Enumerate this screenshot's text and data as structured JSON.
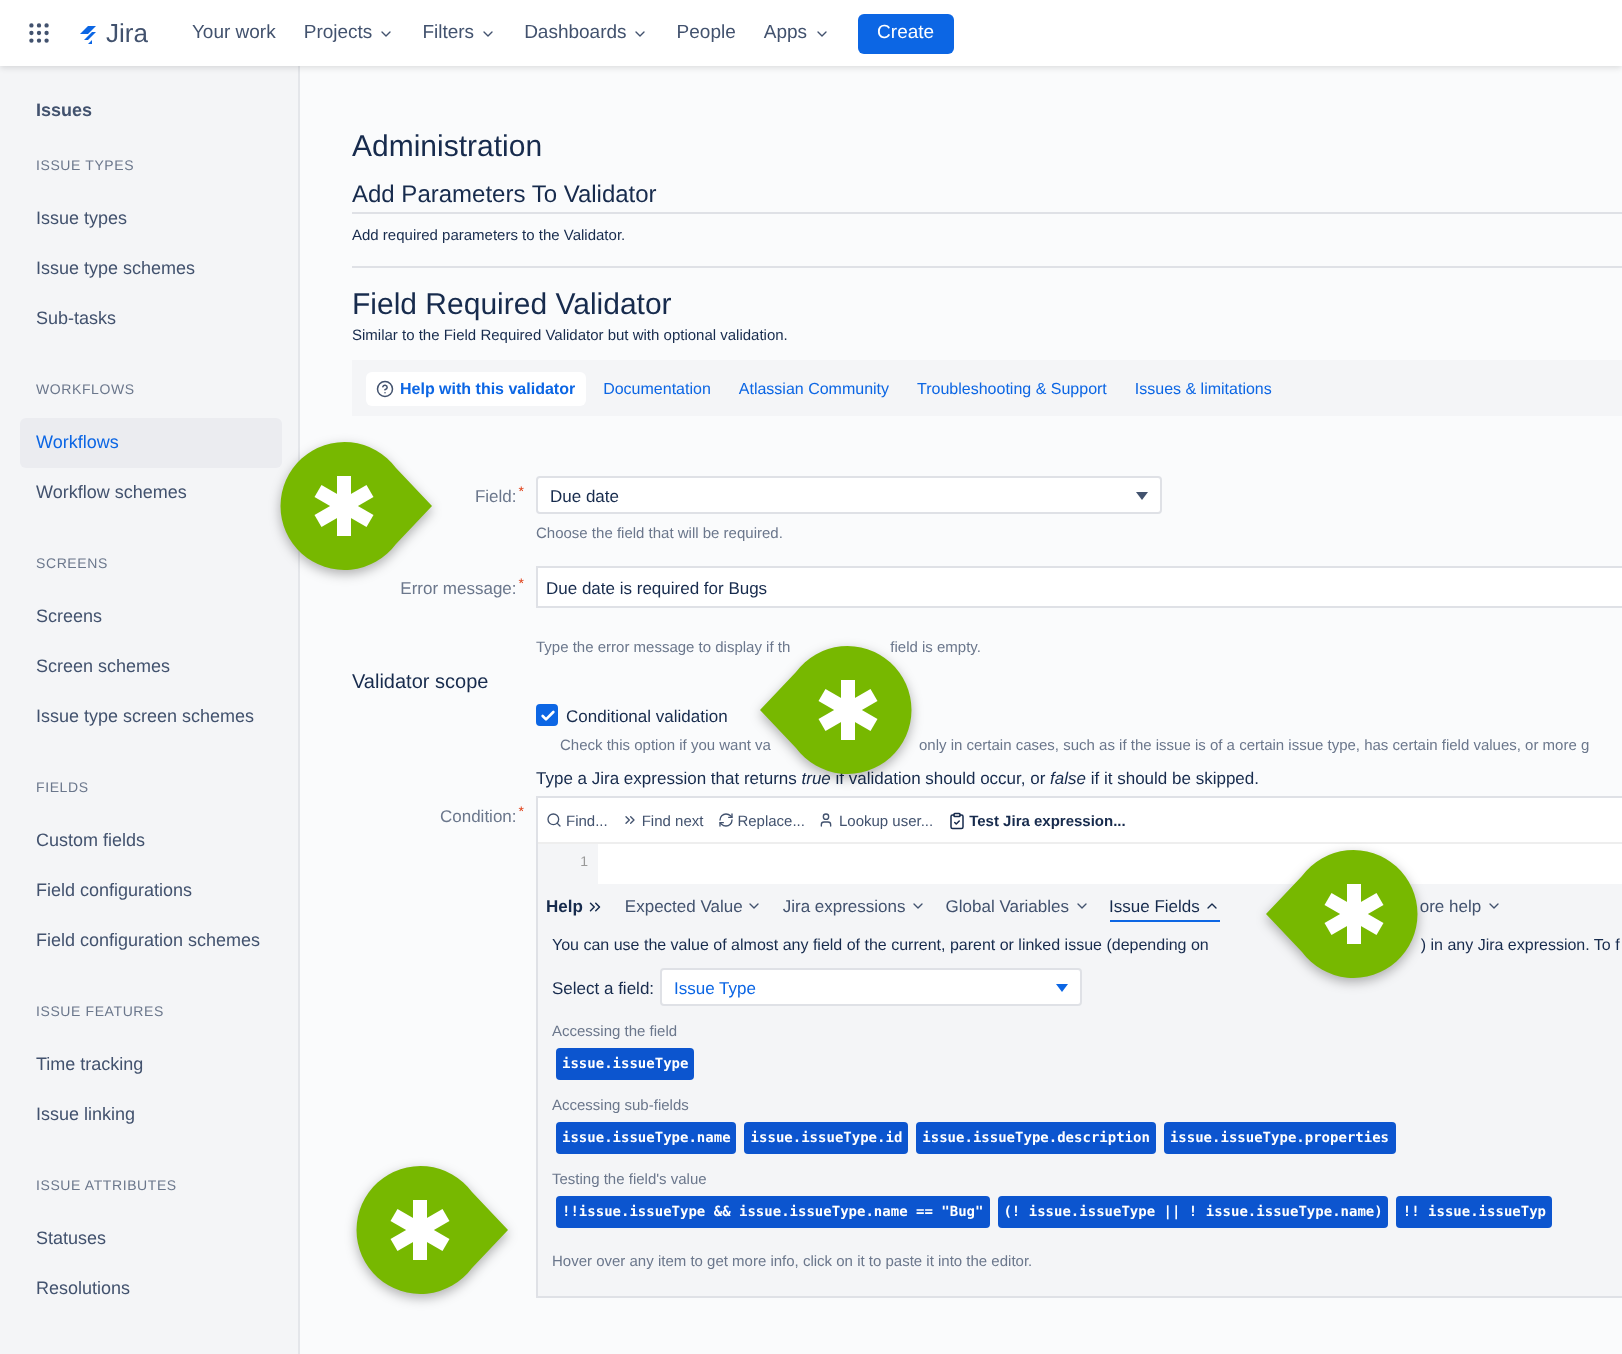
{
  "topbar": {
    "logo": "Jira",
    "nav": [
      {
        "label": "Your work",
        "dropdown": false
      },
      {
        "label": "Projects",
        "dropdown": true
      },
      {
        "label": "Filters",
        "dropdown": true
      },
      {
        "label": "Dashboards",
        "dropdown": true
      },
      {
        "label": "People",
        "dropdown": false
      },
      {
        "label": "Apps",
        "dropdown": true
      }
    ],
    "create": "Create"
  },
  "sidebar": {
    "title": "Issues",
    "sections": [
      {
        "heading": "ISSUE TYPES",
        "items": [
          {
            "label": "Issue types",
            "selected": false
          },
          {
            "label": "Issue type schemes",
            "selected": false
          },
          {
            "label": "Sub-tasks",
            "selected": false
          }
        ]
      },
      {
        "heading": "WORKFLOWS",
        "items": [
          {
            "label": "Workflows",
            "selected": true
          },
          {
            "label": "Workflow schemes",
            "selected": false
          }
        ]
      },
      {
        "heading": "SCREENS",
        "items": [
          {
            "label": "Screens",
            "selected": false
          },
          {
            "label": "Screen schemes",
            "selected": false
          },
          {
            "label": "Issue type screen schemes",
            "selected": false
          }
        ]
      },
      {
        "heading": "FIELDS",
        "items": [
          {
            "label": "Custom fields",
            "selected": false
          },
          {
            "label": "Field configurations",
            "selected": false
          },
          {
            "label": "Field configuration schemes",
            "selected": false
          }
        ]
      },
      {
        "heading": "ISSUE FEATURES",
        "items": [
          {
            "label": "Time tracking",
            "selected": false
          },
          {
            "label": "Issue linking",
            "selected": false
          }
        ]
      },
      {
        "heading": "ISSUE ATTRIBUTES",
        "items": [
          {
            "label": "Statuses",
            "selected": false
          },
          {
            "label": "Resolutions",
            "selected": false
          }
        ]
      }
    ]
  },
  "page": {
    "title": "Administration",
    "section_title": "Add Parameters To Validator",
    "section_desc": "Add required parameters to the Validator.",
    "validator_title": "Field Required Validator",
    "validator_desc": "Similar to the Field Required Validator but with optional validation.",
    "help_tabs": [
      {
        "label": "Help with this validator",
        "selected": true
      },
      {
        "label": "Documentation",
        "selected": false
      },
      {
        "label": "Atlassian Community",
        "selected": false
      },
      {
        "label": "Troubleshooting & Support",
        "selected": false
      },
      {
        "label": "Issues & limitations",
        "selected": false
      }
    ],
    "required_mark": "*",
    "field": {
      "label": "Field:",
      "value": "Due date",
      "hint": "Choose the field that will be required."
    },
    "error_message": {
      "label": "Error message:",
      "value": "Due date is required for Bugs",
      "hint_parts": [
        "Type the error message to display if th",
        "field is empty."
      ]
    },
    "scope": {
      "title": "Validator scope",
      "checkbox": {
        "label": "Conditional validation",
        "checked": true
      },
      "hint_parts": [
        "Check this option if you want va",
        "only in certain cases, such as if the issue is of a certain issue type, has certain field values, or more g"
      ],
      "expression_hint": "Type a Jira expression that returns *true* if validation should occur, or *false* if it should be skipped."
    },
    "condition": {
      "label": "Condition:",
      "toolbar": [
        {
          "label": "Find...",
          "kind": "find"
        },
        {
          "label": "Find next",
          "kind": "next"
        },
        {
          "label": "Replace...",
          "kind": "replace"
        },
        {
          "label": "Lookup user...",
          "kind": "user"
        },
        {
          "label": "Test Jira expression...",
          "kind": "test"
        }
      ],
      "line_number": "1",
      "help_title": "Help",
      "help_menu": [
        {
          "label": "Expected Value",
          "expanded": false
        },
        {
          "label": "Jira expressions",
          "expanded": false
        },
        {
          "label": "Global Variables",
          "expanded": false
        },
        {
          "label": "Issue Fields",
          "expanded": true
        },
        {
          "label": "ore help",
          "expanded": false
        }
      ],
      "desc_parts": [
        "You can use the value of almost any field of the current, parent or linked issue (depending on",
        ") in any Jira expression. To f"
      ],
      "select_label": "Select a field:",
      "select_value": "Issue Type",
      "groups": [
        {
          "label": "Accessing the field",
          "chips": [
            "issue.issueType"
          ]
        },
        {
          "label": "Accessing sub-fields",
          "chips": [
            "issue.issueType.name",
            "issue.issueType.id",
            "issue.issueType.description",
            "issue.issueType.properties"
          ]
        },
        {
          "label": "Testing the field's value",
          "chips": [
            "!!issue.issueType && issue.issueType.name == \"Bug\"",
            "(! issue.issueType || ! issue.issueType.name)",
            "!! issue.issueTyp"
          ]
        }
      ],
      "footer": "Hover over any item to get more info, click on it to paste it into the editor."
    }
  }
}
